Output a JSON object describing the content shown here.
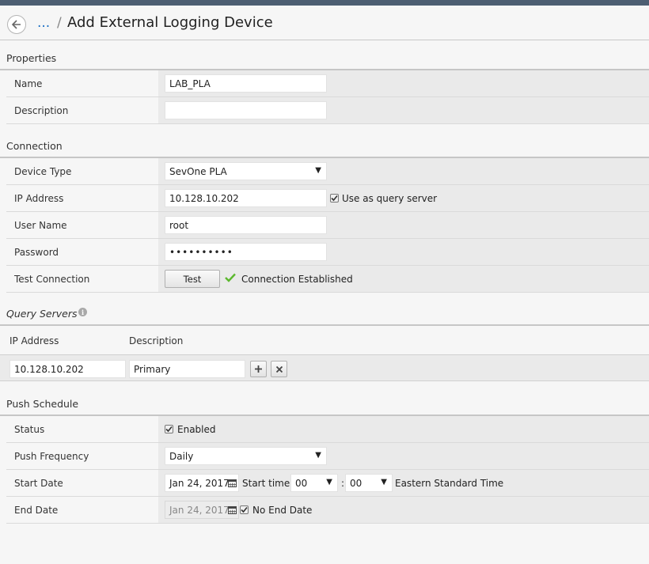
{
  "header": {
    "breadcrumb_ellipsis": "...",
    "separator": "/",
    "title": "Add External Logging Device"
  },
  "sections": {
    "properties": "Properties",
    "connection": "Connection",
    "query_servers": "Query Servers",
    "push_schedule": "Push Schedule"
  },
  "properties": {
    "name_label": "Name",
    "name_value": "LAB_PLA",
    "description_label": "Description",
    "description_value": ""
  },
  "connection": {
    "device_type_label": "Device Type",
    "device_type_value": "SevOne PLA",
    "ip_label": "IP Address",
    "ip_value": "10.128.10.202",
    "use_as_query_label": "Use as query server",
    "use_as_query_checked": true,
    "user_label": "User Name",
    "user_value": "root",
    "password_label": "Password",
    "password_value": "••••••••••",
    "test_label": "Test Connection",
    "test_button": "Test",
    "test_status": "Connection Established"
  },
  "query_servers": {
    "columns": [
      "IP Address",
      "Description"
    ],
    "rows": [
      {
        "ip": "10.128.10.202",
        "description": "Primary"
      }
    ]
  },
  "push_schedule": {
    "status_label": "Status",
    "enabled_label": "Enabled",
    "enabled_checked": true,
    "frequency_label": "Push Frequency",
    "frequency_value": "Daily",
    "start_label": "Start Date",
    "start_value": "Jan 24, 2017",
    "start_time_label": "Start time:",
    "hour_value": "00",
    "time_sep": ":",
    "minute_value": "00",
    "timezone": "Eastern Standard Time",
    "end_label": "End Date",
    "end_value": "Jan 24, 2017",
    "no_end_label": "No End Date",
    "no_end_checked": true
  },
  "colors": {
    "accent": "#1a6fc4",
    "topbar": "#4d5e72",
    "success": "#5cb82e"
  }
}
